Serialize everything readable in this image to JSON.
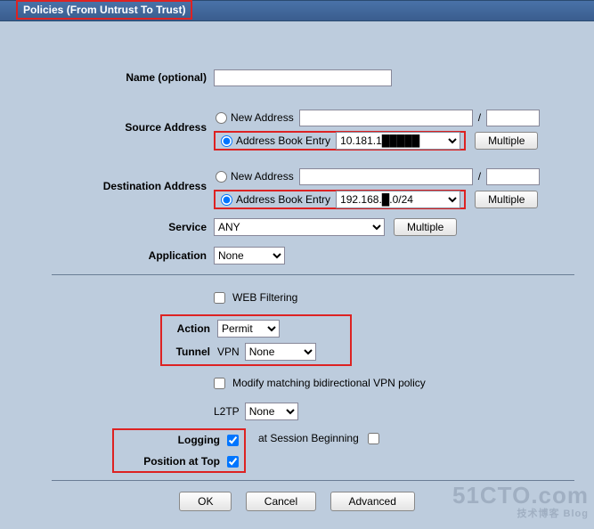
{
  "header": {
    "title": "Policies (From Untrust To Trust)"
  },
  "name": {
    "label": "Name (optional)",
    "value": ""
  },
  "source": {
    "label": "Source Address",
    "new_label": "New Address",
    "new_value": "",
    "book_label": "Address Book Entry",
    "book_value": "10.181.1█████",
    "multiple": "Multiple",
    "slash": "/"
  },
  "dest": {
    "label": "Destination Address",
    "new_label": "New Address",
    "new_value": "",
    "book_label": "Address Book Entry",
    "book_value": "192.168.█.0/24",
    "multiple": "Multiple",
    "slash": "/"
  },
  "service": {
    "label": "Service",
    "value": "ANY",
    "multiple": "Multiple"
  },
  "application": {
    "label": "Application",
    "value": "None"
  },
  "webfilter": {
    "label": "WEB Filtering"
  },
  "action": {
    "label": "Action",
    "value": "Permit"
  },
  "tunnel": {
    "label": "Tunnel",
    "vpn_label": "VPN",
    "vpn_value": "None"
  },
  "modify_bidir": {
    "label": "Modify matching bidirectional VPN policy"
  },
  "l2tp": {
    "label": "L2TP",
    "value": "None"
  },
  "logging": {
    "label": "Logging",
    "session_label": "at Session Beginning"
  },
  "position": {
    "label": "Position at Top"
  },
  "buttons": {
    "ok": "OK",
    "cancel": "Cancel",
    "advanced": "Advanced"
  },
  "watermark": {
    "main": "51CTO.com",
    "sub": "技术博客 Blog"
  }
}
